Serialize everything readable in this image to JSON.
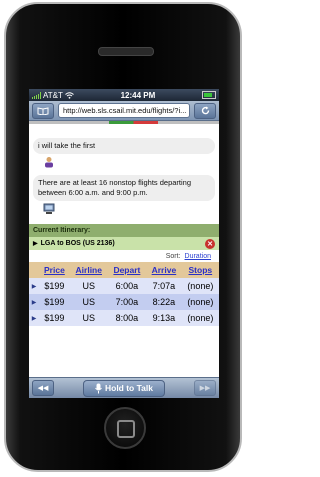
{
  "status": {
    "carrier": "AT&T",
    "time": "12:44 PM"
  },
  "browser": {
    "url": "http://web.sls.csail.mit.edu/flights/?i..."
  },
  "chat": [
    {
      "text": "i will take the first"
    },
    {
      "text": "There are at least 16 nonstop flights departing between 6:00 a.m. and 9:00 p.m."
    }
  ],
  "itinerary": {
    "header": "Current Itinerary:",
    "route": "LGA to BOS (US 2136)"
  },
  "sort": {
    "label": "Sort:",
    "value": "Duration"
  },
  "table": {
    "headers": [
      "Price",
      "Airline",
      "Depart",
      "Arrive",
      "Stops"
    ],
    "rows": [
      [
        "$199",
        "US",
        "6:00a",
        "7:07a",
        "(none)"
      ],
      [
        "$199",
        "US",
        "7:00a",
        "8:22a",
        "(none)"
      ],
      [
        "$199",
        "US",
        "8:00a",
        "9:13a",
        "(none)"
      ]
    ]
  },
  "toolbar": {
    "talk_label": "Hold to Talk"
  },
  "icons": [
    "signal-icon",
    "wifi-icon",
    "battery-icon",
    "bookmarks-icon",
    "reload-icon",
    "user-icon",
    "computer-icon",
    "close-icon",
    "microphone-icon",
    "rewind-icon",
    "forward-icon"
  ]
}
